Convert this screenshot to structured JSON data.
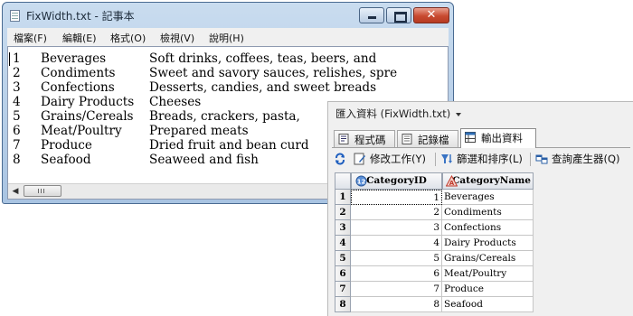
{
  "notepad": {
    "title": "FixWidth.txt - 記事本",
    "menu": [
      "檔案(F)",
      "編輯(E)",
      "格式(O)",
      "檢視(V)",
      "說明(H)"
    ],
    "lines": [
      {
        "id": "1",
        "name": "Beverages",
        "description": "Soft drinks, coffees, teas, beers, and"
      },
      {
        "id": "2",
        "name": "Condiments",
        "description": "Sweet and savory sauces, relishes, spre"
      },
      {
        "id": "3",
        "name": "Confections",
        "description": "Desserts, candies, and sweet breads"
      },
      {
        "id": "4",
        "name": "Dairy Products",
        "description": "Cheeses"
      },
      {
        "id": "5",
        "name": "Grains/Cereals",
        "description": "Breads, crackers, pasta,"
      },
      {
        "id": "6",
        "name": "Meat/Poultry",
        "description": "Prepared meats"
      },
      {
        "id": "7",
        "name": "Produce",
        "description": "Dried fruit and bean curd"
      },
      {
        "id": "8",
        "name": "Seafood",
        "description": "Seaweed and fish"
      }
    ]
  },
  "import_panel": {
    "header": "匯入資料 (FixWidth.txt)",
    "tabs": [
      {
        "label": "程式碼",
        "icon": "code-icon",
        "active": false
      },
      {
        "label": "記錄檔",
        "icon": "log-icon",
        "active": false
      },
      {
        "label": "輸出資料",
        "icon": "output-data-icon",
        "active": true
      }
    ],
    "toolbar": [
      {
        "label": "修改工作(Y)",
        "icon": "modify-task-icon"
      },
      {
        "label": "篩選和排序(L)",
        "icon": "filter-sort-icon"
      },
      {
        "label": "查詢產生器(Q)",
        "icon": "query-builder-icon"
      }
    ],
    "refresh_icon": "refresh-icon",
    "columns": [
      {
        "name": "CategoryID",
        "type_icon": "numeric-column-icon"
      },
      {
        "name": "CategoryName",
        "type_icon": "character-column-icon"
      }
    ],
    "rows": [
      {
        "row": "1",
        "id": "1",
        "name": "Beverages"
      },
      {
        "row": "2",
        "id": "2",
        "name": "Condiments"
      },
      {
        "row": "3",
        "id": "3",
        "name": "Confections"
      },
      {
        "row": "4",
        "id": "4",
        "name": "Dairy Products"
      },
      {
        "row": "5",
        "id": "5",
        "name": "Grains/Cereals"
      },
      {
        "row": "6",
        "id": "6",
        "name": "Meat/Poultry"
      },
      {
        "row": "7",
        "id": "7",
        "name": "Produce"
      },
      {
        "row": "8",
        "id": "8",
        "name": "Seafood"
      }
    ]
  },
  "colors": {
    "window_frame": "#a9c4e2",
    "close_button": "#c84a30",
    "grid_border": "#9aa3b0"
  }
}
